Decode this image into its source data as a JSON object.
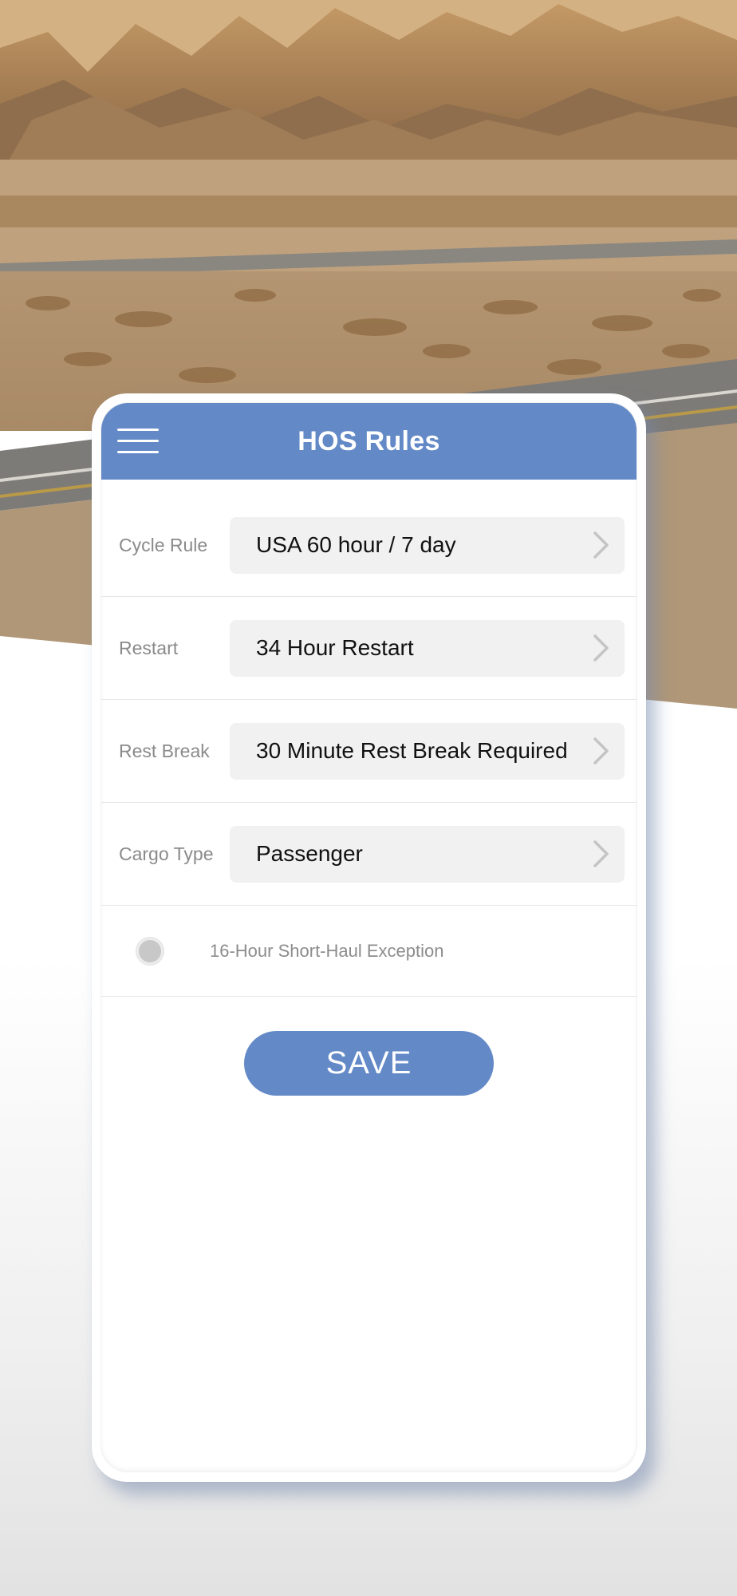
{
  "header": {
    "title": "HOS Rules",
    "menu_icon": "hamburger-menu-icon"
  },
  "settings": [
    {
      "label": "Cycle Rule",
      "value": "USA 60 hour / 7 day",
      "icon": "chevron-right-icon"
    },
    {
      "label": "Restart",
      "value": "34 Hour Restart",
      "icon": "chevron-right-icon"
    },
    {
      "label": "Rest Break",
      "value": "30 Minute Rest Break Required",
      "icon": "chevron-right-icon"
    },
    {
      "label": "Cargo Type",
      "value": "Passenger",
      "icon": "chevron-right-icon"
    }
  ],
  "exception": {
    "label": "16-Hour Short-Haul Exception",
    "selected": false
  },
  "save_label": "SAVE",
  "colors": {
    "accent": "#6389c7",
    "field_bg": "#f1f1f1",
    "label_text": "#8a8a8a"
  }
}
